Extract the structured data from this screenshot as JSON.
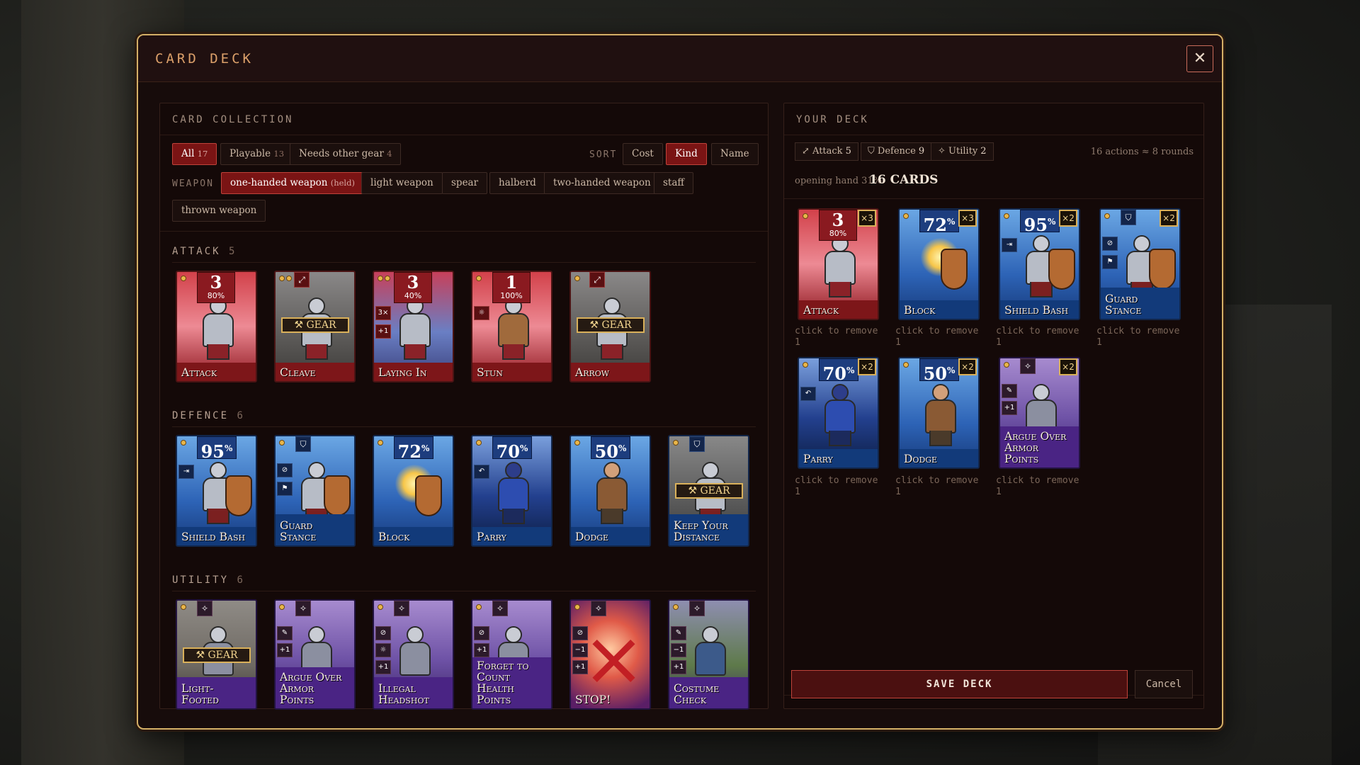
{
  "modal": {
    "title": "CARD DECK",
    "close_icon": "close-icon"
  },
  "collection": {
    "title": "CARD COLLECTION",
    "filters": [
      {
        "label": "All",
        "count": "17",
        "active": true
      },
      {
        "label": "Playable",
        "count": "13",
        "active": false
      },
      {
        "label": "Needs other gear",
        "count": "4",
        "active": false
      }
    ],
    "sort_label": "SORT",
    "sort_options": [
      {
        "label": "Cost",
        "active": false
      },
      {
        "label": "Kind",
        "active": true
      },
      {
        "label": "Name",
        "active": false
      }
    ],
    "weapon_label": "WEAPON",
    "weapons": [
      {
        "label": "one-handed weapon",
        "note": "(held)",
        "active": true
      },
      {
        "label": "light weapon",
        "active": false
      },
      {
        "label": "spear",
        "active": false
      },
      {
        "label": "halberd",
        "active": false
      },
      {
        "label": "two-handed weapon",
        "active": false
      },
      {
        "label": "staff",
        "active": false
      },
      {
        "label": "thrown weapon",
        "active": false
      }
    ],
    "sections": {
      "attack": {
        "title": "ATTACK",
        "count": "5",
        "cards": [
          {
            "name": "Attack",
            "value": "3",
            "pct": "80%"
          },
          {
            "name": "Cleave",
            "gear": "GEAR"
          },
          {
            "name": "Laying In",
            "value": "3",
            "pct": "40%",
            "badge_a": "3×",
            "badge_b": "+1"
          },
          {
            "name": "Stun",
            "value": "1",
            "pct": "100%"
          },
          {
            "name": "Arrow",
            "gear": "GEAR"
          }
        ]
      },
      "defence": {
        "title": "DEFENCE",
        "count": "6",
        "cards": [
          {
            "name": "Shield Bash",
            "pct": "95"
          },
          {
            "name": "Guard Stance"
          },
          {
            "name": "Block",
            "pct": "72"
          },
          {
            "name": "Parry",
            "pct": "70"
          },
          {
            "name": "Dodge",
            "pct": "50"
          },
          {
            "name": "Keep Your Distance",
            "gear": "GEAR"
          }
        ]
      },
      "utility": {
        "title": "UTILITY",
        "count": "6",
        "cards": [
          {
            "name": "Light-Footed",
            "gear": "GEAR"
          },
          {
            "name": "Argue Over Armor Points",
            "badge_b": "+1"
          },
          {
            "name": "Illegal Headshot",
            "badge_b": "+1"
          },
          {
            "name": "Forget to Count Health Points",
            "badge_b": "+1"
          },
          {
            "name": "STOP!",
            "badge_a": "−1",
            "badge_b": "+1"
          },
          {
            "name": "Costume Check",
            "badge_a": "−1",
            "badge_b": "+1"
          }
        ]
      }
    }
  },
  "deck": {
    "title": "YOUR DECK",
    "tags": [
      {
        "label": "Attack",
        "count": "5",
        "icon": "sword-icon"
      },
      {
        "label": "Defence",
        "count": "9",
        "icon": "shield-icon"
      },
      {
        "label": "Utility",
        "count": "2",
        "icon": "sparkle-icon"
      }
    ],
    "actions_summary": "16 actions ≈ 8 rounds",
    "opening_hand": "opening hand 31%",
    "card_count": "16 CARDS",
    "remove_hint": "click to remove",
    "cards": [
      {
        "name": "Attack",
        "value": "3",
        "pct": "80%",
        "mult": "×3",
        "qty": "1"
      },
      {
        "name": "Block",
        "pct": "72",
        "mult": "×3",
        "qty": "1"
      },
      {
        "name": "Shield Bash",
        "pct": "95",
        "mult": "×2",
        "qty": "1"
      },
      {
        "name": "Guard Stance",
        "mult": "×2",
        "qty": "1"
      },
      {
        "name": "Parry",
        "pct": "70",
        "mult": "×2",
        "qty": "1"
      },
      {
        "name": "Dodge",
        "pct": "50",
        "mult": "×2",
        "qty": "1"
      },
      {
        "name": "Argue Over Armor Points",
        "mult": "×2",
        "qty": "1",
        "badge_b": "+1"
      }
    ],
    "save_label": "SAVE DECK",
    "cancel_label": "Cancel"
  }
}
